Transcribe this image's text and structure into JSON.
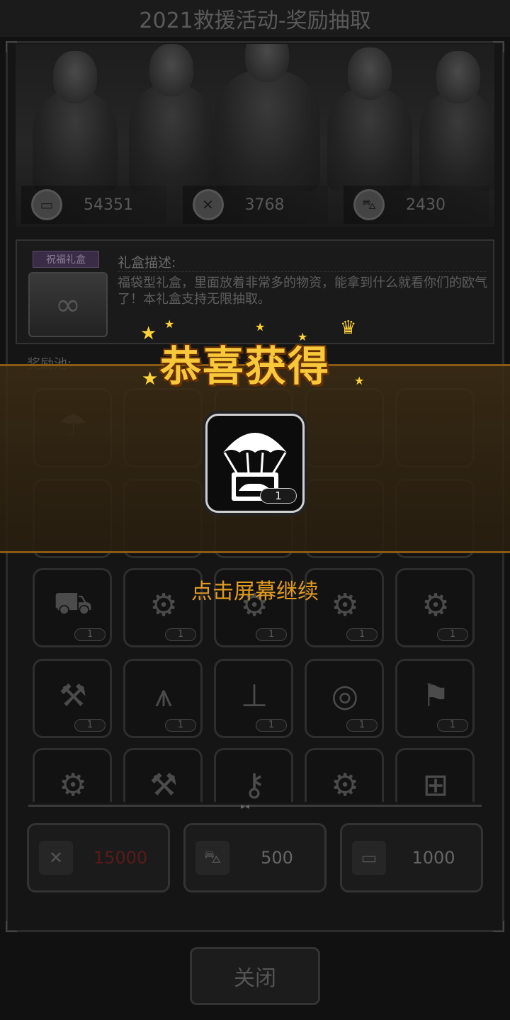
{
  "title": "2021救援活动-奖励抽取",
  "currencies": [
    {
      "icon": "card-icon",
      "value": "54351"
    },
    {
      "icon": "hammer-x-icon",
      "value": "3768"
    },
    {
      "icon": "car-icon",
      "value": "2430"
    }
  ],
  "gift": {
    "tag": "祝福礼盒",
    "desc_title": "礼盒描述:",
    "desc_body": "福袋型礼盒，里面放着非常多的物资，能拿到什么就看你们的欧气了！本礼盒支持无限抽取。"
  },
  "pool_label": "奖励池:",
  "pool_items": [
    {
      "icon": "trunk-icon",
      "qty": "1"
    },
    {
      "icon": "exhaust-icon",
      "qty": "1"
    },
    {
      "icon": "engine-icon",
      "qty": "1"
    },
    {
      "icon": "gearbox-icon",
      "qty": "1"
    },
    {
      "icon": "engine-block-icon",
      "qty": "1"
    },
    {
      "icon": "bumper-icon",
      "qty": "1"
    },
    {
      "icon": "spike-bar-icon",
      "qty": "1"
    },
    {
      "icon": "axle-icon",
      "qty": "1"
    },
    {
      "icon": "tire-icon",
      "qty": "1"
    },
    {
      "icon": "fender-icon",
      "qty": "1"
    }
  ],
  "costs": [
    {
      "icon": "hammer-x-icon",
      "value": "15000",
      "insufficient": true
    },
    {
      "icon": "car-icon",
      "value": "500",
      "insufficient": false
    },
    {
      "icon": "card-icon",
      "value": "1000",
      "insufficient": false
    }
  ],
  "close_label": "关闭",
  "overlay": {
    "title": "恭喜获得",
    "reward_icon": "parachute-car-icon",
    "reward_qty": "1",
    "continue": "点击屏幕继续"
  },
  "colors": {
    "accent": "#f7c83a",
    "continue": "#e09a22",
    "insufficient": "#5b1a1a"
  }
}
